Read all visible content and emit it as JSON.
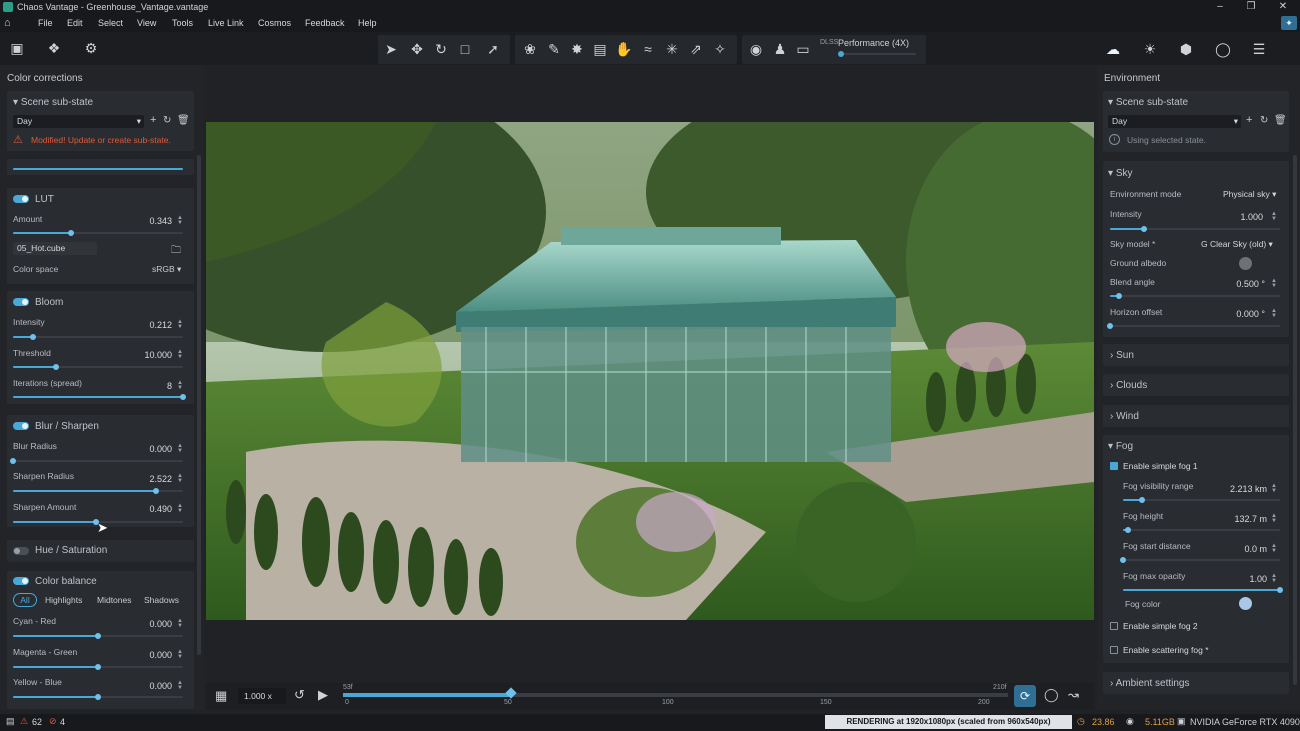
{
  "window": {
    "title": "Chaos Vantage - Greenhouse_Vantage.vantage"
  },
  "menu": [
    "File",
    "Edit",
    "Select",
    "View",
    "Tools",
    "Live Link",
    "Cosmos",
    "Feedback",
    "Help"
  ],
  "toolbar": {
    "performance_label": "Performance (4X)",
    "dlss_label": "DLSS"
  },
  "left": {
    "panel_title": "Color corrections",
    "substate": {
      "title": "Scene sub-state",
      "value": "Day",
      "warning": "Modified! Update or create sub-state."
    },
    "lut": {
      "title": "LUT",
      "amount_label": "Amount",
      "amount": "0.343",
      "amount_level": 0.343,
      "file": "05_Hot.cube",
      "colorspace_label": "Color space",
      "colorspace": "sRGB"
    },
    "bloom": {
      "title": "Bloom",
      "intensity_label": "Intensity",
      "intensity": "0.212",
      "intensity_level": 0.12,
      "threshold_label": "Threshold",
      "threshold": "10.000",
      "threshold_level": 0.25,
      "iterations_label": "Iterations (spread)",
      "iterations": "8",
      "iterations_level": 1.0
    },
    "blur": {
      "title": "Blur / Sharpen",
      "blur_radius_label": "Blur Radius",
      "blur_radius": "0.000",
      "blur_level": 0.0,
      "sharpen_radius_label": "Sharpen Radius",
      "sharpen_radius": "2.522",
      "sharpen_radius_level": 0.84,
      "sharpen_amount_label": "Sharpen Amount",
      "sharpen_amount": "0.490",
      "sharpen_amount_level": 0.49
    },
    "hue": {
      "title": "Hue / Saturation"
    },
    "colorbalance": {
      "title": "Color balance",
      "tabs": [
        "All",
        "Highlights",
        "Midtones",
        "Shadows"
      ],
      "cyan_label": "Cyan - Red",
      "cyan": "0.000",
      "magenta_label": "Magenta - Green",
      "magenta": "0.000",
      "yellow_label": "Yellow - Blue",
      "yellow": "0.000"
    }
  },
  "right": {
    "panel_title": "Environment",
    "substate": {
      "title": "Scene sub-state",
      "value": "Day",
      "info": "Using selected state."
    },
    "sky": {
      "title": "Sky",
      "envmode_label": "Environment mode",
      "envmode": "Physical sky",
      "intensity_label": "Intensity",
      "intensity": "1.000",
      "intensity_level": 0.2,
      "skymodel_label": "Sky model *",
      "skymodel": "G Clear Sky (old)",
      "albedo_label": "Ground albedo",
      "blend_label": "Blend angle",
      "blend": "0.500 °",
      "blend_level": 0.05,
      "horizon_label": "Horizon offset",
      "horizon": "0.000 °",
      "horizon_level": 0.0
    },
    "sun": {
      "title": "Sun"
    },
    "clouds": {
      "title": "Clouds"
    },
    "wind": {
      "title": "Wind"
    },
    "fog": {
      "title": "Fog",
      "fog1_label": "Enable simple fog 1",
      "vis_label": "Fog visibility range",
      "vis": "2.213 km",
      "vis_level": 0.12,
      "height_label": "Fog height",
      "height": "132.7 m",
      "height_level": 0.03,
      "start_label": "Fog start distance",
      "start": "0.0 m",
      "start_level": 0.0,
      "opacity_label": "Fog max opacity",
      "opacity": "1.00",
      "opacity_level": 1.0,
      "color_label": "Fog color",
      "fog2_label": "Enable simple fog 2",
      "scatter_label": "Enable scattering fog *"
    },
    "ambient": {
      "title": "Ambient settings"
    }
  },
  "timeline": {
    "speed": "1.000 x",
    "start_frame": "53f",
    "end_frame": "210f",
    "ticks": [
      "0",
      "50",
      "100",
      "150",
      "200"
    ],
    "playhead": "50"
  },
  "status": {
    "warnings": "62",
    "errors": "4",
    "render_msg": "RENDERING at 1920x1080px (scaled from 960x540px)",
    "fps": "23.86",
    "vram": "5.11GB",
    "gpu": "NVIDIA GeForce RTX 4090"
  },
  "colors": {
    "accent": "#4aa8d8",
    "warning": "#e05a3a",
    "bg": "#202226"
  }
}
